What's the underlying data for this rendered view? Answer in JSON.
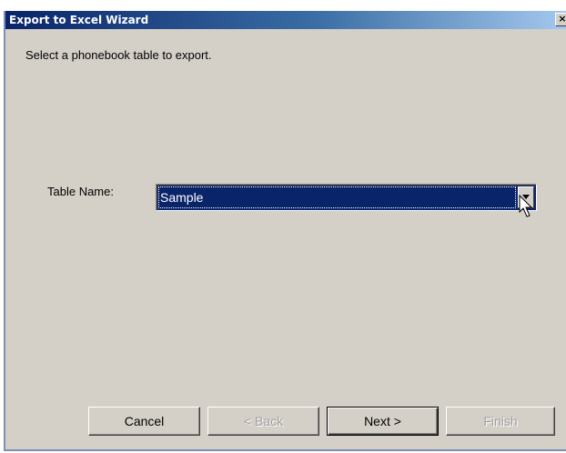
{
  "window": {
    "title": "Export to Excel Wizard",
    "close_glyph": "×"
  },
  "instruction": "Select a phonebook table to export.",
  "table_field": {
    "label": "Table Name:",
    "selected_value": "Sample"
  },
  "buttons": {
    "cancel": "Cancel",
    "back": "< Back",
    "next": "Next >",
    "finish": "Finish"
  },
  "colors": {
    "dialog_background": "#d4d0c8",
    "selection_background": "#0a246a",
    "title_bar_start": "#0a246a",
    "disabled_text": "#a0a0a0"
  },
  "icons": {
    "close": "close-icon",
    "dropdown": "chevron-down-icon",
    "cursor": "mouse-pointer-icon"
  }
}
